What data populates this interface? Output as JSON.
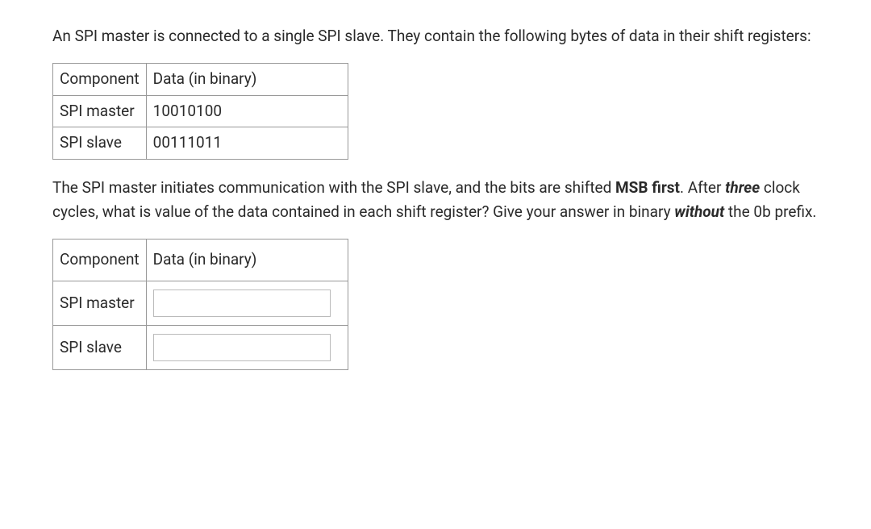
{
  "intro_text": "An SPI master is connected to a single SPI slave. They contain the following bytes of data in their shift registers:",
  "table1": {
    "header_col1": "Component",
    "header_col2": "Data (in binary)",
    "rows": [
      {
        "component": "SPI master",
        "data": "10010100"
      },
      {
        "component": "SPI slave",
        "data": "00111011"
      }
    ]
  },
  "question": {
    "part1": "The SPI master initiates communication with the SPI slave, and the bits are shifted ",
    "msb_first": "MSB first",
    "part2": ". After ",
    "three": "three",
    "part3": " clock cycles, what is value of the data contained in each shift register? Give your answer in binary ",
    "without": "without",
    "part4": " the 0b prefix."
  },
  "table2": {
    "header_col1": "Component",
    "header_col2": "Data (in binary)",
    "rows": [
      {
        "component": "SPI master",
        "value": ""
      },
      {
        "component": "SPI slave",
        "value": ""
      }
    ]
  }
}
